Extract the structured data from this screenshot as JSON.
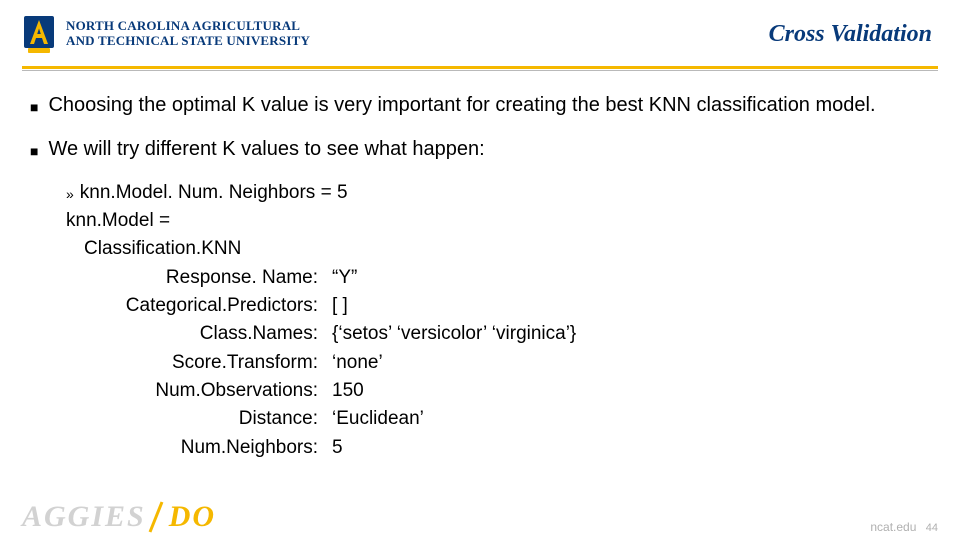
{
  "header": {
    "university_line1": "NORTH CAROLINA AGRICULTURAL",
    "university_line2": "AND TECHNICAL STATE UNIVERSITY",
    "slide_title": "Cross Validation"
  },
  "bullets": [
    "Choosing the optimal K value is very important for creating the best KNN classification model.",
    "We will try different K values to see what happen:"
  ],
  "code": {
    "command": "knn.Model. Num. Neighbors = 5",
    "object_header": "knn.Model =",
    "class_name": "Classification.KNN",
    "props": [
      {
        "label": "Response. Name:",
        "value": "“Y”"
      },
      {
        "label": "Categorical.Predictors:",
        "value": "[ ]"
      },
      {
        "label": "Class.Names:",
        "value": "{‘setos’ ‘versicolor’       ‘virginica’}"
      },
      {
        "label": "Score.Transform:",
        "value": " ‘none’"
      },
      {
        "label": "Num.Observations:",
        "value": "150"
      },
      {
        "label": "Distance:",
        "value": "‘Euclidean’"
      },
      {
        "label": "Num.Neighbors:",
        "value": "5"
      }
    ]
  },
  "footer": {
    "watermark_left": "AGGIES",
    "watermark_right": "DO",
    "site": "ncat.edu",
    "page": "44"
  }
}
